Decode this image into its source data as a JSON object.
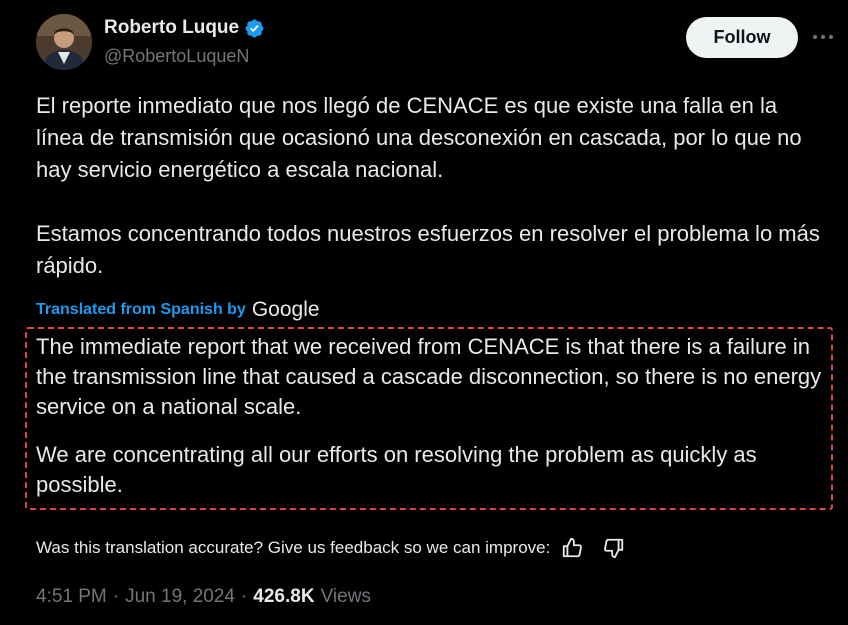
{
  "author": {
    "display_name": "Roberto Luque",
    "handle": "@RobertoLuqueN",
    "verified_icon": "verified-badge-icon",
    "verified_color": "#1d9bf0"
  },
  "actions": {
    "follow_label": "Follow",
    "more_icon": "more-options-icon"
  },
  "tweet": {
    "original_paragraphs": [
      "El reporte inmediato que nos llegó de CENACE es que existe una falla en la línea de transmisión que ocasionó una desconexión en cascada, por lo que no hay servicio energético a escala nacional.",
      "Estamos concentrando todos nuestros esfuerzos en resolver el problema lo más rápido."
    ],
    "translated_label": "Translated from Spanish by",
    "translator": "Google",
    "translation_paragraphs": [
      "The immediate report that we received from CENACE is that there is a failure in the transmission line that caused a cascade disconnection, so there is no energy service on a national scale.",
      "We are concentrating all our efforts on resolving the problem as quickly as possible."
    ],
    "highlight_color": "#e0473e"
  },
  "feedback": {
    "prompt": "Was this translation accurate? Give us feedback so we can improve:",
    "thumbs_up_icon": "thumbs-up-icon",
    "thumbs_down_icon": "thumbs-down-icon"
  },
  "meta": {
    "time": "4:51 PM",
    "date": "Jun 19, 2024",
    "views_count": "426.8K",
    "views_label": "Views"
  },
  "colors": {
    "background": "#000000",
    "text": "#e7e9ea",
    "muted": "#71767b",
    "accent": "#1d9bf0"
  }
}
